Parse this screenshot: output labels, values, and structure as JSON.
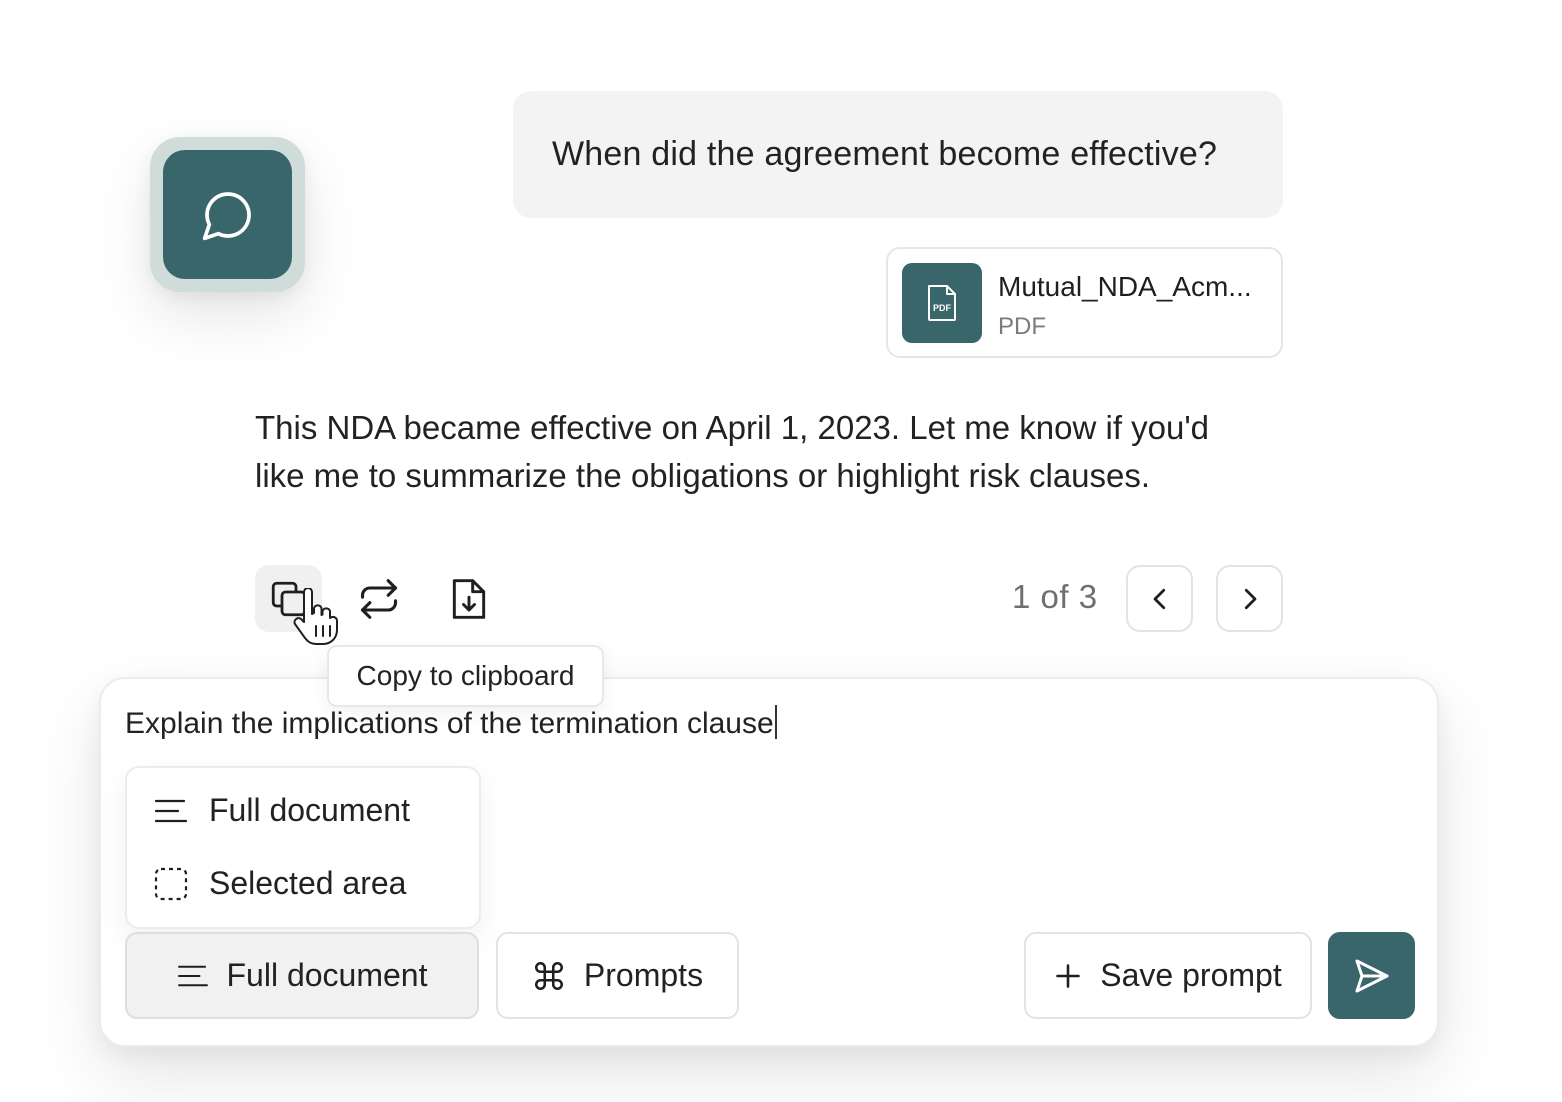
{
  "conversation": {
    "user_message": "When did the agreement become effective?",
    "attachment": {
      "name": "Mutual_NDA_Acm...",
      "type": "PDF",
      "thumb_label": "PDF"
    },
    "assistant_reply": "This NDA became effective on April 1, 2023. Let me know if you'd like me to summarize the obligations or highlight risk clauses.",
    "actions": {
      "copy_icon": "copy-icon",
      "regenerate_icon": "regenerate-icon",
      "download_icon": "download-document-icon"
    },
    "tooltip": "Copy to clipboard",
    "pager": {
      "text": "1 of 3"
    }
  },
  "composer": {
    "input_value": "Explain the implications of the termination clause",
    "scope_menu": {
      "items": [
        {
          "label": "Full document",
          "icon": "lines-icon"
        },
        {
          "label": "Selected area",
          "icon": "dashed-square-icon"
        }
      ]
    },
    "scope_button": {
      "label": "Full document"
    },
    "prompts_button": {
      "label": "Prompts"
    },
    "save_prompt_button": {
      "label": "Save prompt"
    },
    "send_button": {
      "icon": "send-icon"
    }
  },
  "colors": {
    "accent": "#39666a",
    "accent_light": "#cfdcda"
  }
}
